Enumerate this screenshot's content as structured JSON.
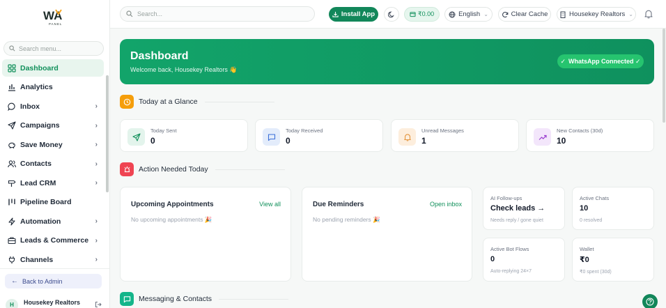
{
  "sidebar": {
    "logo_text": "WA",
    "logo_subtext": "PANEL",
    "search_placeholder": "Search menu...",
    "items": [
      {
        "label": "Dashboard",
        "icon": "grid-icon",
        "active": true,
        "has_children": false
      },
      {
        "label": "Analytics",
        "icon": "bar-chart-icon",
        "active": false,
        "has_children": false
      },
      {
        "label": "Inbox",
        "icon": "chat-bubble-icon",
        "active": false,
        "has_children": true
      },
      {
        "label": "Campaigns",
        "icon": "send-icon",
        "active": false,
        "has_children": true
      },
      {
        "label": "Save Money",
        "icon": "piggy-bank-icon",
        "active": false,
        "has_children": true
      },
      {
        "label": "Contacts",
        "icon": "users-icon",
        "active": false,
        "has_children": true
      },
      {
        "label": "Lead CRM",
        "icon": "signpost-icon",
        "active": false,
        "has_children": true
      },
      {
        "label": "Pipeline Board",
        "icon": "kanban-icon",
        "active": false,
        "has_children": false
      },
      {
        "label": "Automation",
        "icon": "bolt-icon",
        "active": false,
        "has_children": true
      },
      {
        "label": "Leads & Commerce",
        "icon": "briefcase-icon",
        "active": false,
        "has_children": true
      },
      {
        "label": "Channels",
        "icon": "plug-icon",
        "active": false,
        "has_children": true
      }
    ],
    "chevron": "›",
    "back_label": "Back to Admin",
    "user_initial": "H",
    "user_name": "Housekey Realtors"
  },
  "topbar": {
    "search_placeholder": "Search...",
    "install_label": "Install App",
    "wallet_balance": "₹0.00",
    "language": "English",
    "clear_cache_label": "Clear Cache",
    "org_name": "Housekey Realtors"
  },
  "hero": {
    "title": "Dashboard",
    "subtitle": "Welcome back, Housekey Realtors 👋",
    "status_badge": "WhatsApp Connected ✓"
  },
  "sections": {
    "glance": "Today at a Glance",
    "action": "Action Needed Today",
    "messaging": "Messaging & Contacts"
  },
  "stats": [
    {
      "label": "Today Sent",
      "value": "0",
      "icon": "send-icon",
      "color": "#11905b",
      "bg": "#e3f4ec"
    },
    {
      "label": "Today Received",
      "value": "0",
      "icon": "message-square-icon",
      "color": "#3b6fd8",
      "bg": "#e3ecfb"
    },
    {
      "label": "Unread Messages",
      "value": "1",
      "icon": "bell-icon",
      "color": "#e08a2b",
      "bg": "#fdeedd"
    },
    {
      "label": "New Contacts (30d)",
      "value": "10",
      "icon": "trending-up-icon",
      "color": "#9b3fd0",
      "bg": "#f3e6fb"
    }
  ],
  "panels": {
    "appointments": {
      "title": "Upcoming Appointments",
      "link": "View all",
      "empty": "No upcoming appointments 🎉"
    },
    "reminders": {
      "title": "Due Reminders",
      "link": "Open inbox",
      "empty": "No pending reminders 🎉"
    }
  },
  "mini_cards": [
    {
      "label": "AI Follow-ups",
      "value": "Check leads →",
      "sub": "Needs reply / gone quiet"
    },
    {
      "label": "Active Chats",
      "value": "10",
      "sub": "0 resolved"
    },
    {
      "label": "Active Bot Flows",
      "value": "0",
      "sub": "Auto-replying 24×7"
    },
    {
      "label": "Wallet",
      "value": "₹0",
      "sub": "₹0 spent (30d)"
    }
  ],
  "colors": {
    "brand": "#12875a",
    "accent_green": "#11905b",
    "glance_icon_bg": "#f59e0b",
    "action_icon_bg": "#ef4452",
    "messaging_icon_bg": "#14b58a"
  }
}
